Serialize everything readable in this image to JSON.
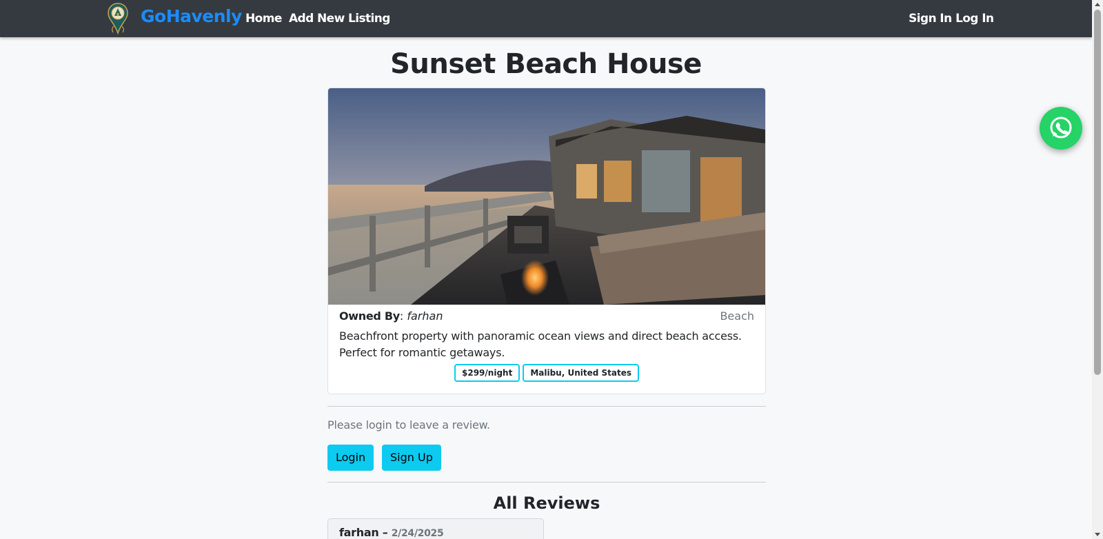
{
  "brand": {
    "name": "GoHavenly",
    "logo_icon": "location-pin-logo-icon",
    "accent": "#1a8cff"
  },
  "nav": {
    "home": "Home",
    "add_listing": "Add New Listing",
    "sign_in": "Sign In",
    "log_in": "Log In"
  },
  "listing": {
    "title": "Sunset Beach House",
    "owner_label": "Owned By",
    "owner_sep": ": ",
    "owner": "farhan",
    "category": "Beach",
    "description": "Beachfront property with panoramic ocean views and direct beach access. Perfect for romantic getaways.",
    "price": "$299/night",
    "location": "Malibu, United States"
  },
  "review_section": {
    "login_prompt": "Please login to leave a review.",
    "login_button": "Login",
    "signup_button": "Sign Up",
    "all_reviews_title": "All Reviews",
    "reviews": [
      {
        "author": "farhan",
        "separator": " – ",
        "date": "2/24/2025"
      }
    ]
  },
  "colors": {
    "navbar": "#343a40",
    "button": "#0dcaf0",
    "whatsapp": "#25d366"
  },
  "floating": {
    "whatsapp_icon": "whatsapp-icon"
  }
}
